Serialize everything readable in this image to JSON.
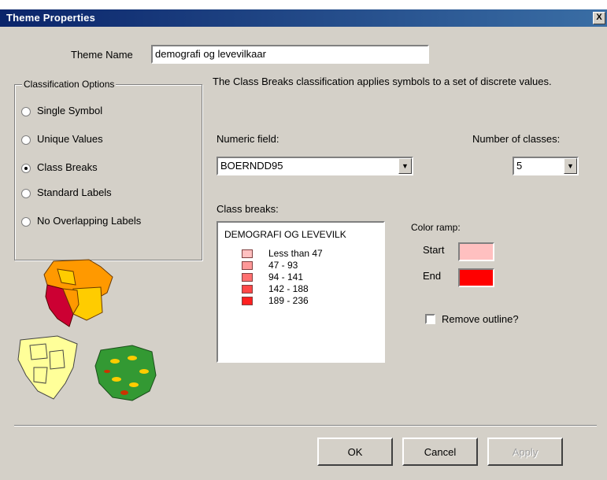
{
  "window": {
    "title": "Theme Properties",
    "close_glyph": "X"
  },
  "theme_name": {
    "label": "Theme Name",
    "value": "demografi og levevilkaar"
  },
  "classification": {
    "group_title": "Classification Options",
    "options": [
      {
        "label": "Single Symbol",
        "selected": false
      },
      {
        "label": "Unique Values",
        "selected": false
      },
      {
        "label": "Class Breaks",
        "selected": true
      },
      {
        "label": "Standard Labels",
        "selected": false
      },
      {
        "label": "No Overlapping Labels",
        "selected": false
      }
    ]
  },
  "description": "The Class Breaks classification applies symbols to a set of discrete values.",
  "numeric_field": {
    "label": "Numeric field:",
    "value": "BOERNDD95"
  },
  "num_classes": {
    "label": "Number of classes:",
    "value": "5"
  },
  "class_breaks": {
    "label": "Class breaks:",
    "header": "DEMOGRAFI OG LEVEVILK",
    "items": [
      {
        "label": "Less than 47",
        "color": "#ffc0c0"
      },
      {
        "label": "47 - 93",
        "color": "#ff9898"
      },
      {
        "label": "94 - 141",
        "color": "#ff7070"
      },
      {
        "label": "142 - 188",
        "color": "#ff4848"
      },
      {
        "label": "189 - 236",
        "color": "#ff2020"
      }
    ]
  },
  "color_ramp": {
    "label": "Color ramp:",
    "start_label": "Start",
    "start_color": "#ffc0c0",
    "end_label": "End",
    "end_color": "#ff0000"
  },
  "remove_outline": {
    "label": "Remove outline?",
    "checked": false
  },
  "buttons": {
    "ok": "OK",
    "cancel": "Cancel",
    "apply": "Apply"
  },
  "colors": {
    "titlebar": "#0a246a",
    "dialog_bg": "#d4d0c8"
  }
}
